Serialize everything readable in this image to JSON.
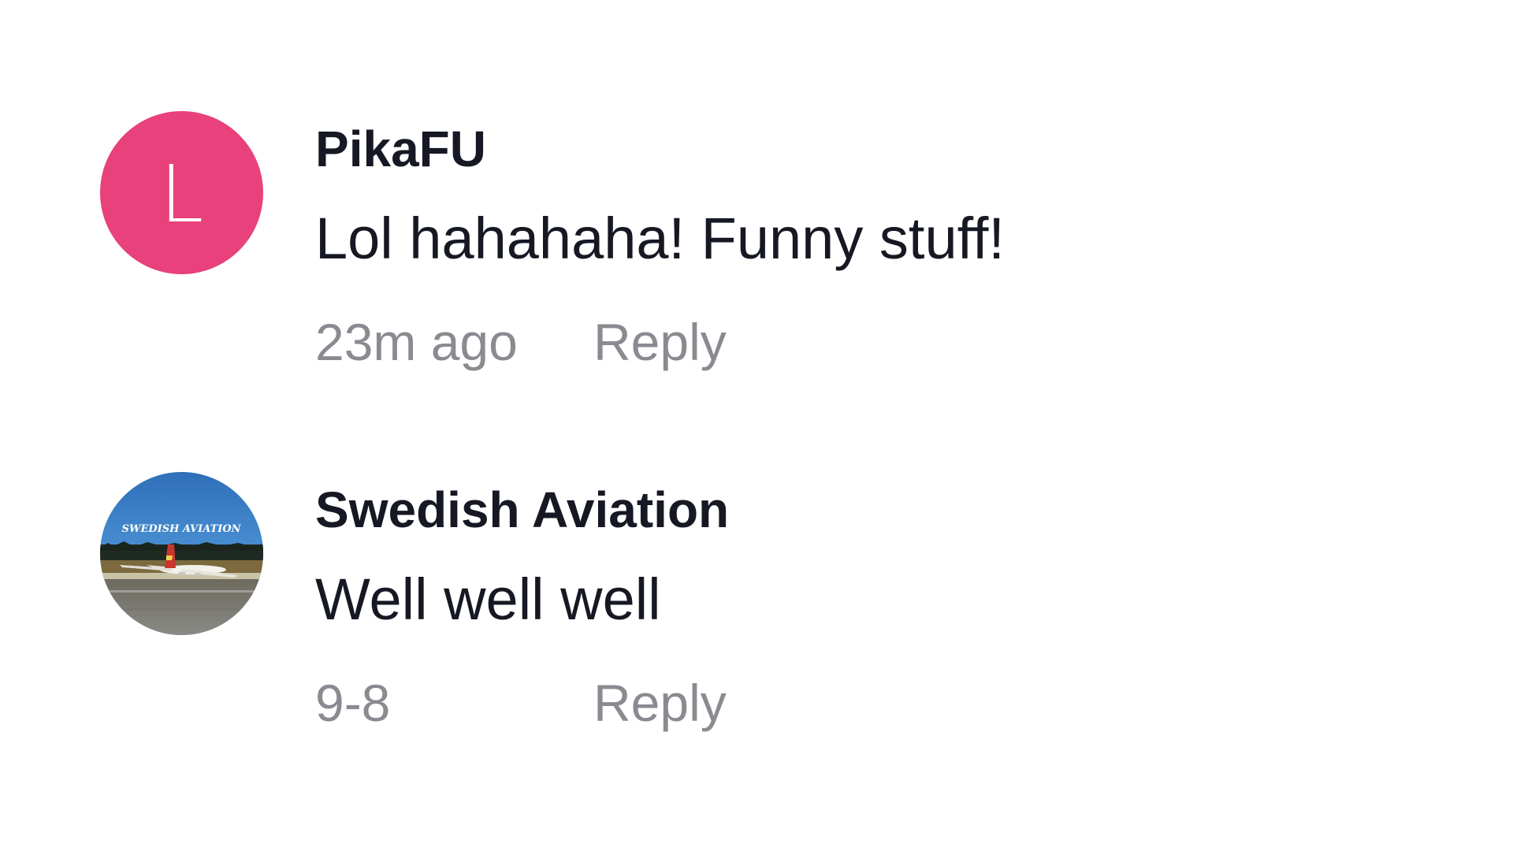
{
  "comments": [
    {
      "avatar": {
        "type": "letter",
        "letter": "L",
        "background": "#e8417c"
      },
      "username": "PikaFU",
      "text": "Lol hahahaha! Funny stuff!",
      "time": "23m ago",
      "reply_label": "Reply"
    },
    {
      "avatar": {
        "type": "photo",
        "logo_text": "SWEDISH AVIATION",
        "description_icon": "airplane-photo"
      },
      "username": "Swedish Aviation",
      "text": "Well well well",
      "time": "9-8",
      "reply_label": "Reply"
    }
  ],
  "colors": {
    "text_primary": "#161823",
    "text_secondary": "#8a8b91",
    "avatar_pink": "#e8417c"
  }
}
